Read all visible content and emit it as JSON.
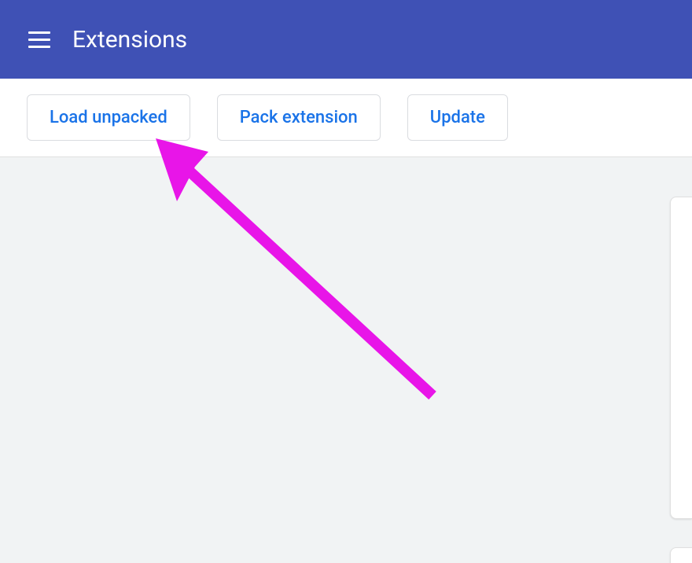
{
  "header": {
    "title": "Extensions"
  },
  "toolbar": {
    "buttons": {
      "load_unpacked": "Load unpacked",
      "pack_extension": "Pack extension",
      "update": "Update"
    }
  },
  "annotation": {
    "arrow_color": "#e815e8"
  }
}
